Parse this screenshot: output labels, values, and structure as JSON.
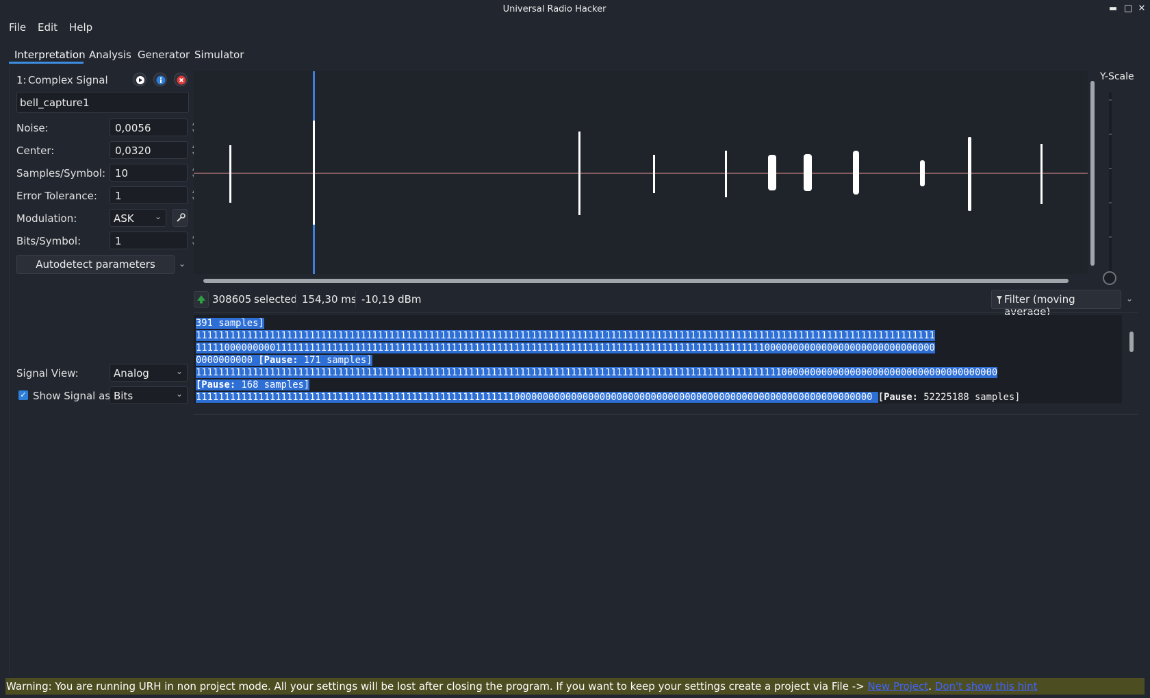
{
  "window": {
    "title": "Universal Radio Hacker"
  },
  "menu": [
    "File",
    "Edit",
    "Help"
  ],
  "tabs": [
    "Interpretation",
    "Analysis",
    "Generator",
    "Simulator"
  ],
  "signal": {
    "index_label": "1:",
    "type_label": "Complex Signal",
    "name": "bell_capture1",
    "params": [
      {
        "label": "Noise:",
        "value": "0,0056"
      },
      {
        "label": "Center:",
        "value": "0,0320"
      },
      {
        "label": "Samples/Symbol:",
        "value": "10"
      },
      {
        "label": "Error Tolerance:",
        "value": "1"
      }
    ],
    "modulation_label": "Modulation:",
    "modulation_value": "ASK",
    "bits_symbol_label": "Bits/Symbol:",
    "bits_symbol_value": "1",
    "autodetect_label": "Autodetect parameters",
    "signal_view_label": "Signal View:",
    "signal_view_value": "Analog",
    "show_signal_as_label": "Show Signal as",
    "show_signal_as_value": "Bits"
  },
  "graph": {
    "yscale_label": "Y-Scale",
    "colors": {
      "signal": "#ffffff",
      "center_line": "#e05a5a",
      "selection": "#3d7fe0"
    }
  },
  "info": {
    "selected_count": "308605",
    "selected_label": "selected",
    "duration": "154,30 ms",
    "power": "-10,19 dBm",
    "filter_label": "Filter (moving average)"
  },
  "bits_view": {
    "line1_a": "391 samples]",
    "line2": "1111111111111111111111111111111111111111111111111111111111111111111111111111111111111111111111111111111111111111111111111111111111",
    "line3": "1111100000000011111111111111111111111111111111111111111111111111111111111111111111111111111111111111000000000000000000000000000000",
    "line4_a": "0000000000 ",
    "pause_word": "[Pause:",
    "line4_b": " 171 samples]",
    "line5": "111111111111111111111111111111111111111111111111111111111111111111111111111111111111111111111111111111100000000000000000000000000000000000000",
    "line6_b": " 168 samples]",
    "line7_a": "11111111111111111111111111111111111111111111111111111111000000000000000000000000000000000000000000000000000000000000000 ",
    "line7_b": " 52225188 samples]"
  },
  "status": {
    "warning_text": "Warning: You are running URH in non project mode. All your settings will be lost after closing the program. If you want to keep your settings create a project via File -> ",
    "link_new_project": "New Project",
    "separator": ". ",
    "link_dont_show": "Don't show this hint"
  }
}
